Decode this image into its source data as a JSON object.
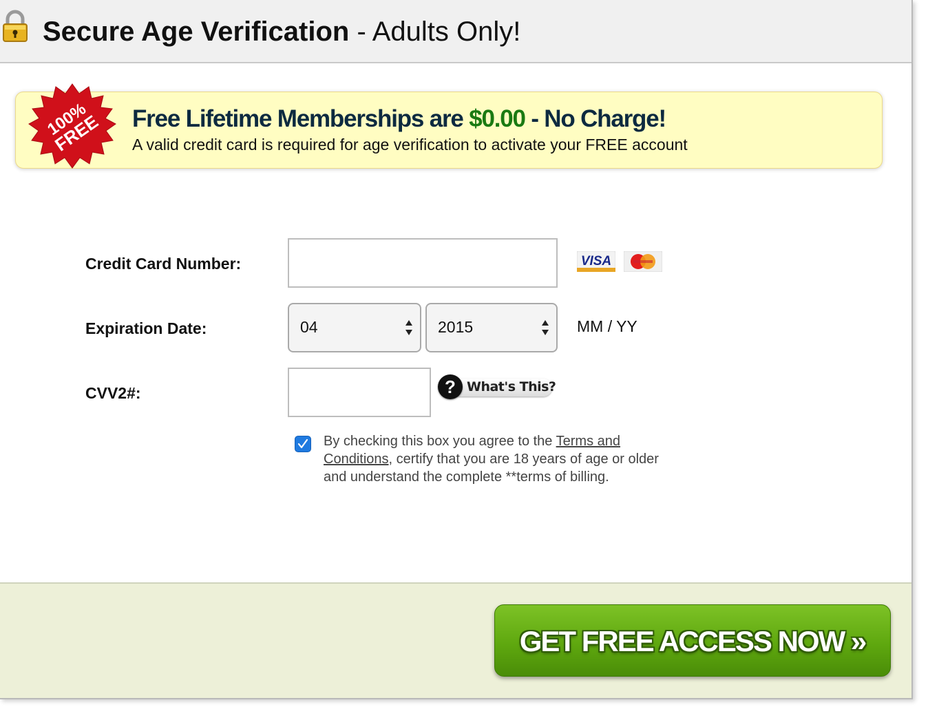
{
  "header": {
    "title_bold": "Secure Age Verification",
    "title_rest": " - Adults Only!",
    "icon": "lock-icon"
  },
  "promo": {
    "badge_line1": "100%",
    "badge_line2": "FREE",
    "headline_part1": "Free Lifetime Memberships are ",
    "headline_price": "$0.00",
    "headline_part2": " - No Charge!",
    "subtext": "A valid credit card is required for age verification to activate your FREE account",
    "price_color": "#1a7a12",
    "badge_color": "#d0101a"
  },
  "form": {
    "card_number": {
      "label": "Credit Card Number:",
      "value": ""
    },
    "card_logos": [
      "VISA",
      "MasterCard"
    ],
    "expiration": {
      "label": "Expiration Date:",
      "month": "04",
      "year": "2015",
      "format_hint": "MM / YY"
    },
    "cvv": {
      "label": "CVV2#:",
      "value": "",
      "help_label": "What's This?",
      "help_icon": "question-icon"
    },
    "agree": {
      "checked": true,
      "text_before": "By checking this box you agree to the ",
      "link": "Terms and Conditions",
      "text_after": ", certify that you are 18 years of age or older and understand the complete **terms of billing."
    }
  },
  "footer": {
    "cta_label": "GET FREE ACCESS NOW »",
    "cta_color": "#5fa80f"
  }
}
